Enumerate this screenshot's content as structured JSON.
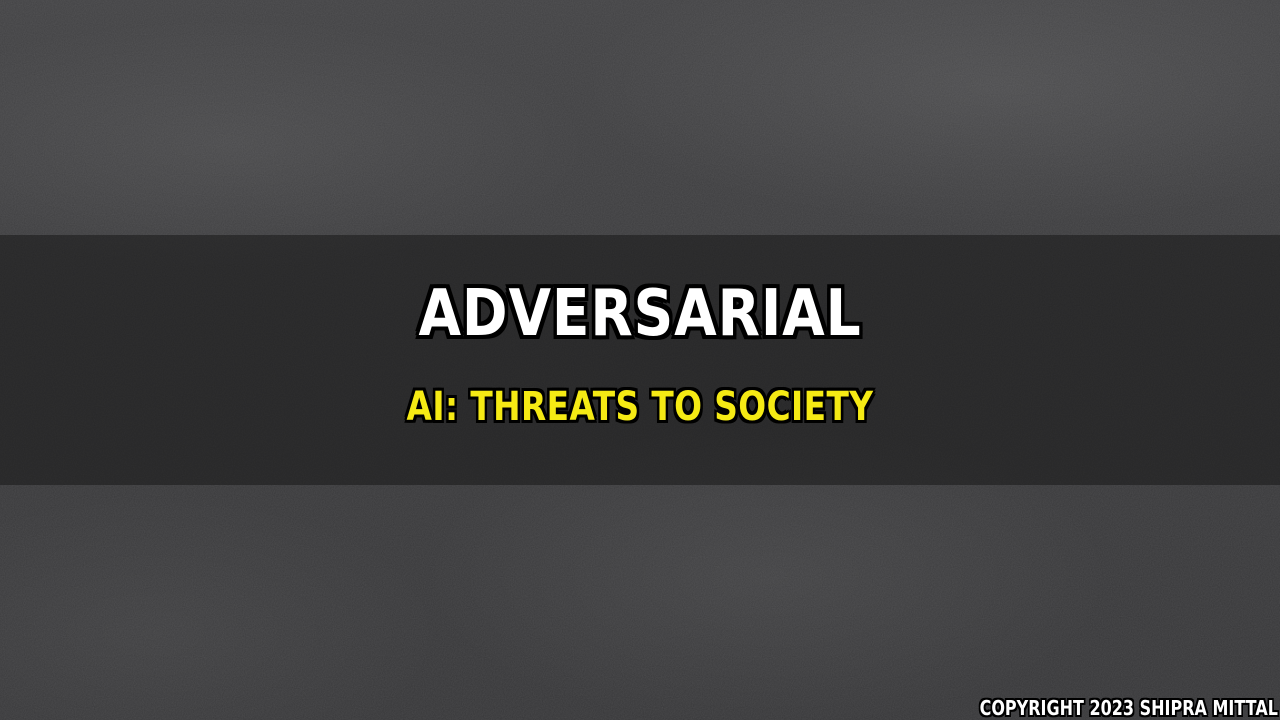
{
  "slide": {
    "title": "ADVERSARIAL",
    "subtitle": "AI: THREATS TO SOCIETY",
    "copyright": "COPYRIGHT 2023 SHIPRA MITTAL"
  },
  "colors": {
    "background": "#3b3b3d",
    "band": "#181818",
    "title": "#ffffff",
    "subtitle": "#f5ea14",
    "outline": "#000000"
  }
}
